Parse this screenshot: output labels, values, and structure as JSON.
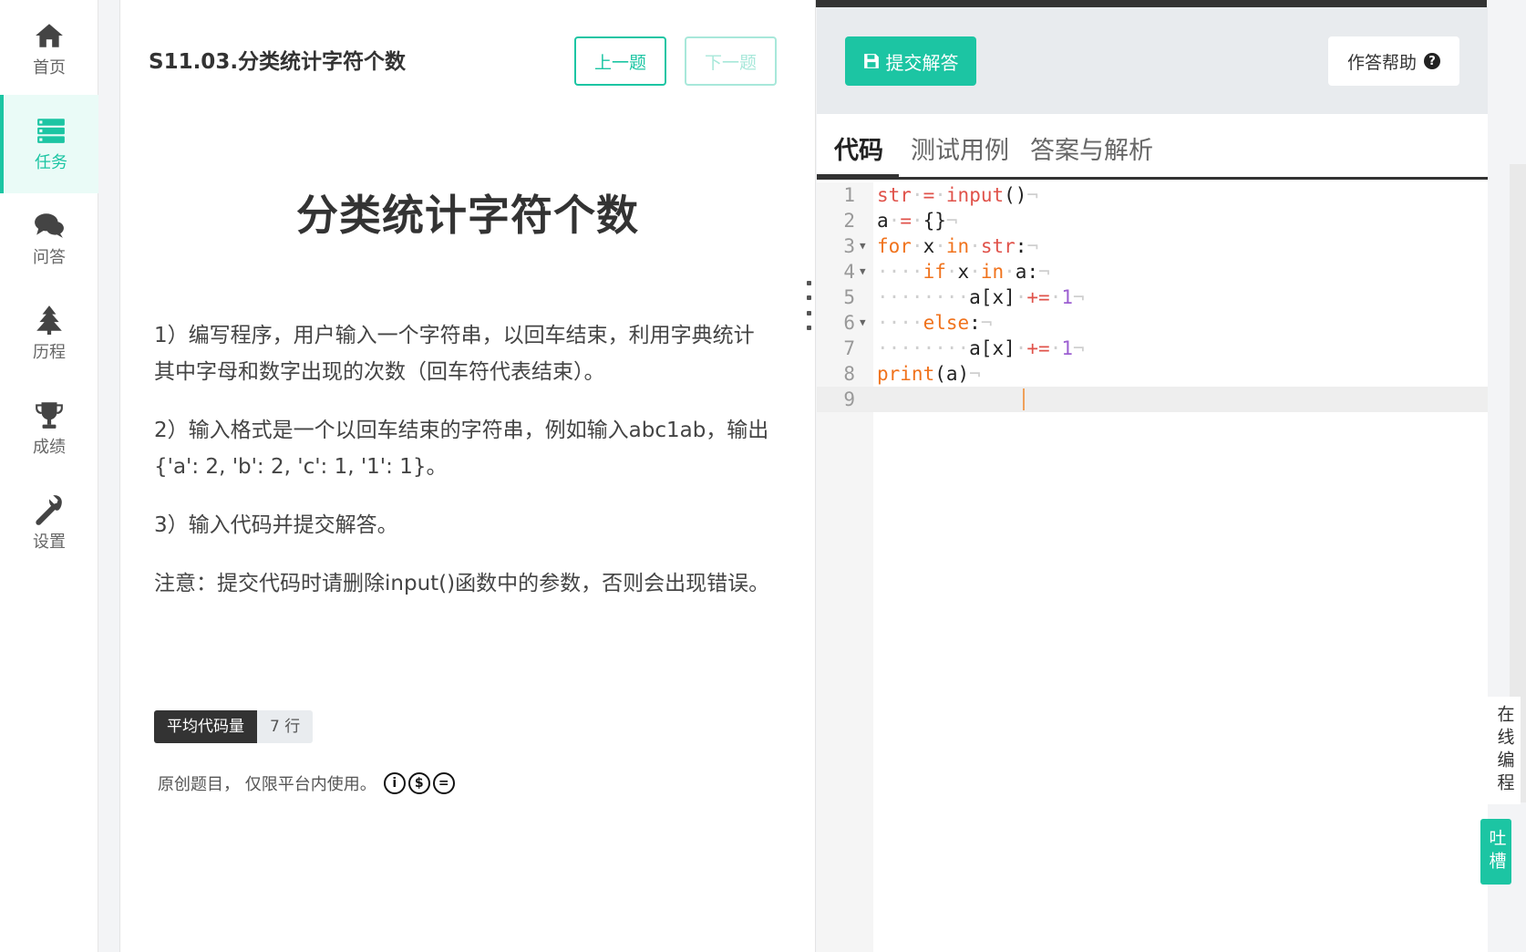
{
  "sidebar": {
    "items": [
      {
        "label": "首页",
        "icon": "home-icon"
      },
      {
        "label": "任务",
        "icon": "tasks-icon",
        "active": true
      },
      {
        "label": "问答",
        "icon": "comments-icon"
      },
      {
        "label": "历程",
        "icon": "tree-icon"
      },
      {
        "label": "成绩",
        "icon": "trophy-icon"
      },
      {
        "label": "设置",
        "icon": "wrench-icon"
      }
    ]
  },
  "problem": {
    "header_title": "S11.03.分类统计字符个数",
    "prev_label": "上一题",
    "next_label": "下一题",
    "title": "分类统计字符个数",
    "paragraphs": [
      "1）编写程序，用户输入一个字符串，以回车结束，利用字典统计其中字母和数字出现的次数（回车符代表结束）。",
      "2）输入格式是一个以回车结束的字符串，例如输入abc1ab，输出{'a': 2, 'b': 2, 'c': 1, '1': 1}。",
      "3）输入代码并提交解答。",
      "注意：提交代码时请删除input()函数中的参数，否则会出现错误。"
    ],
    "badge_key": "平均代码量",
    "badge_value": "7 行",
    "license_text": "原创题目，  仅限平台内使用。"
  },
  "editor": {
    "submit_label": "提交解答",
    "help_label": "作答帮助",
    "tabs": [
      "代码",
      "测试用例",
      "答案与解析"
    ],
    "line_numbers": [
      "1",
      "2",
      "3",
      "4",
      "5",
      "6",
      "7",
      "8",
      "9"
    ],
    "code_lines": [
      "str = input()",
      "a = {}",
      "for x in str:",
      "    if x in a:",
      "        a[x] += 1",
      "    else:",
      "        a[x] += 1",
      "print(a)",
      ""
    ]
  },
  "floating": {
    "online_code": "在线编程",
    "feedback": "吐槽"
  },
  "colors": {
    "accent": "#1cc5a3",
    "keyword": "#f0731d",
    "builtin": "#e0524a",
    "number": "#9c5fd1"
  }
}
